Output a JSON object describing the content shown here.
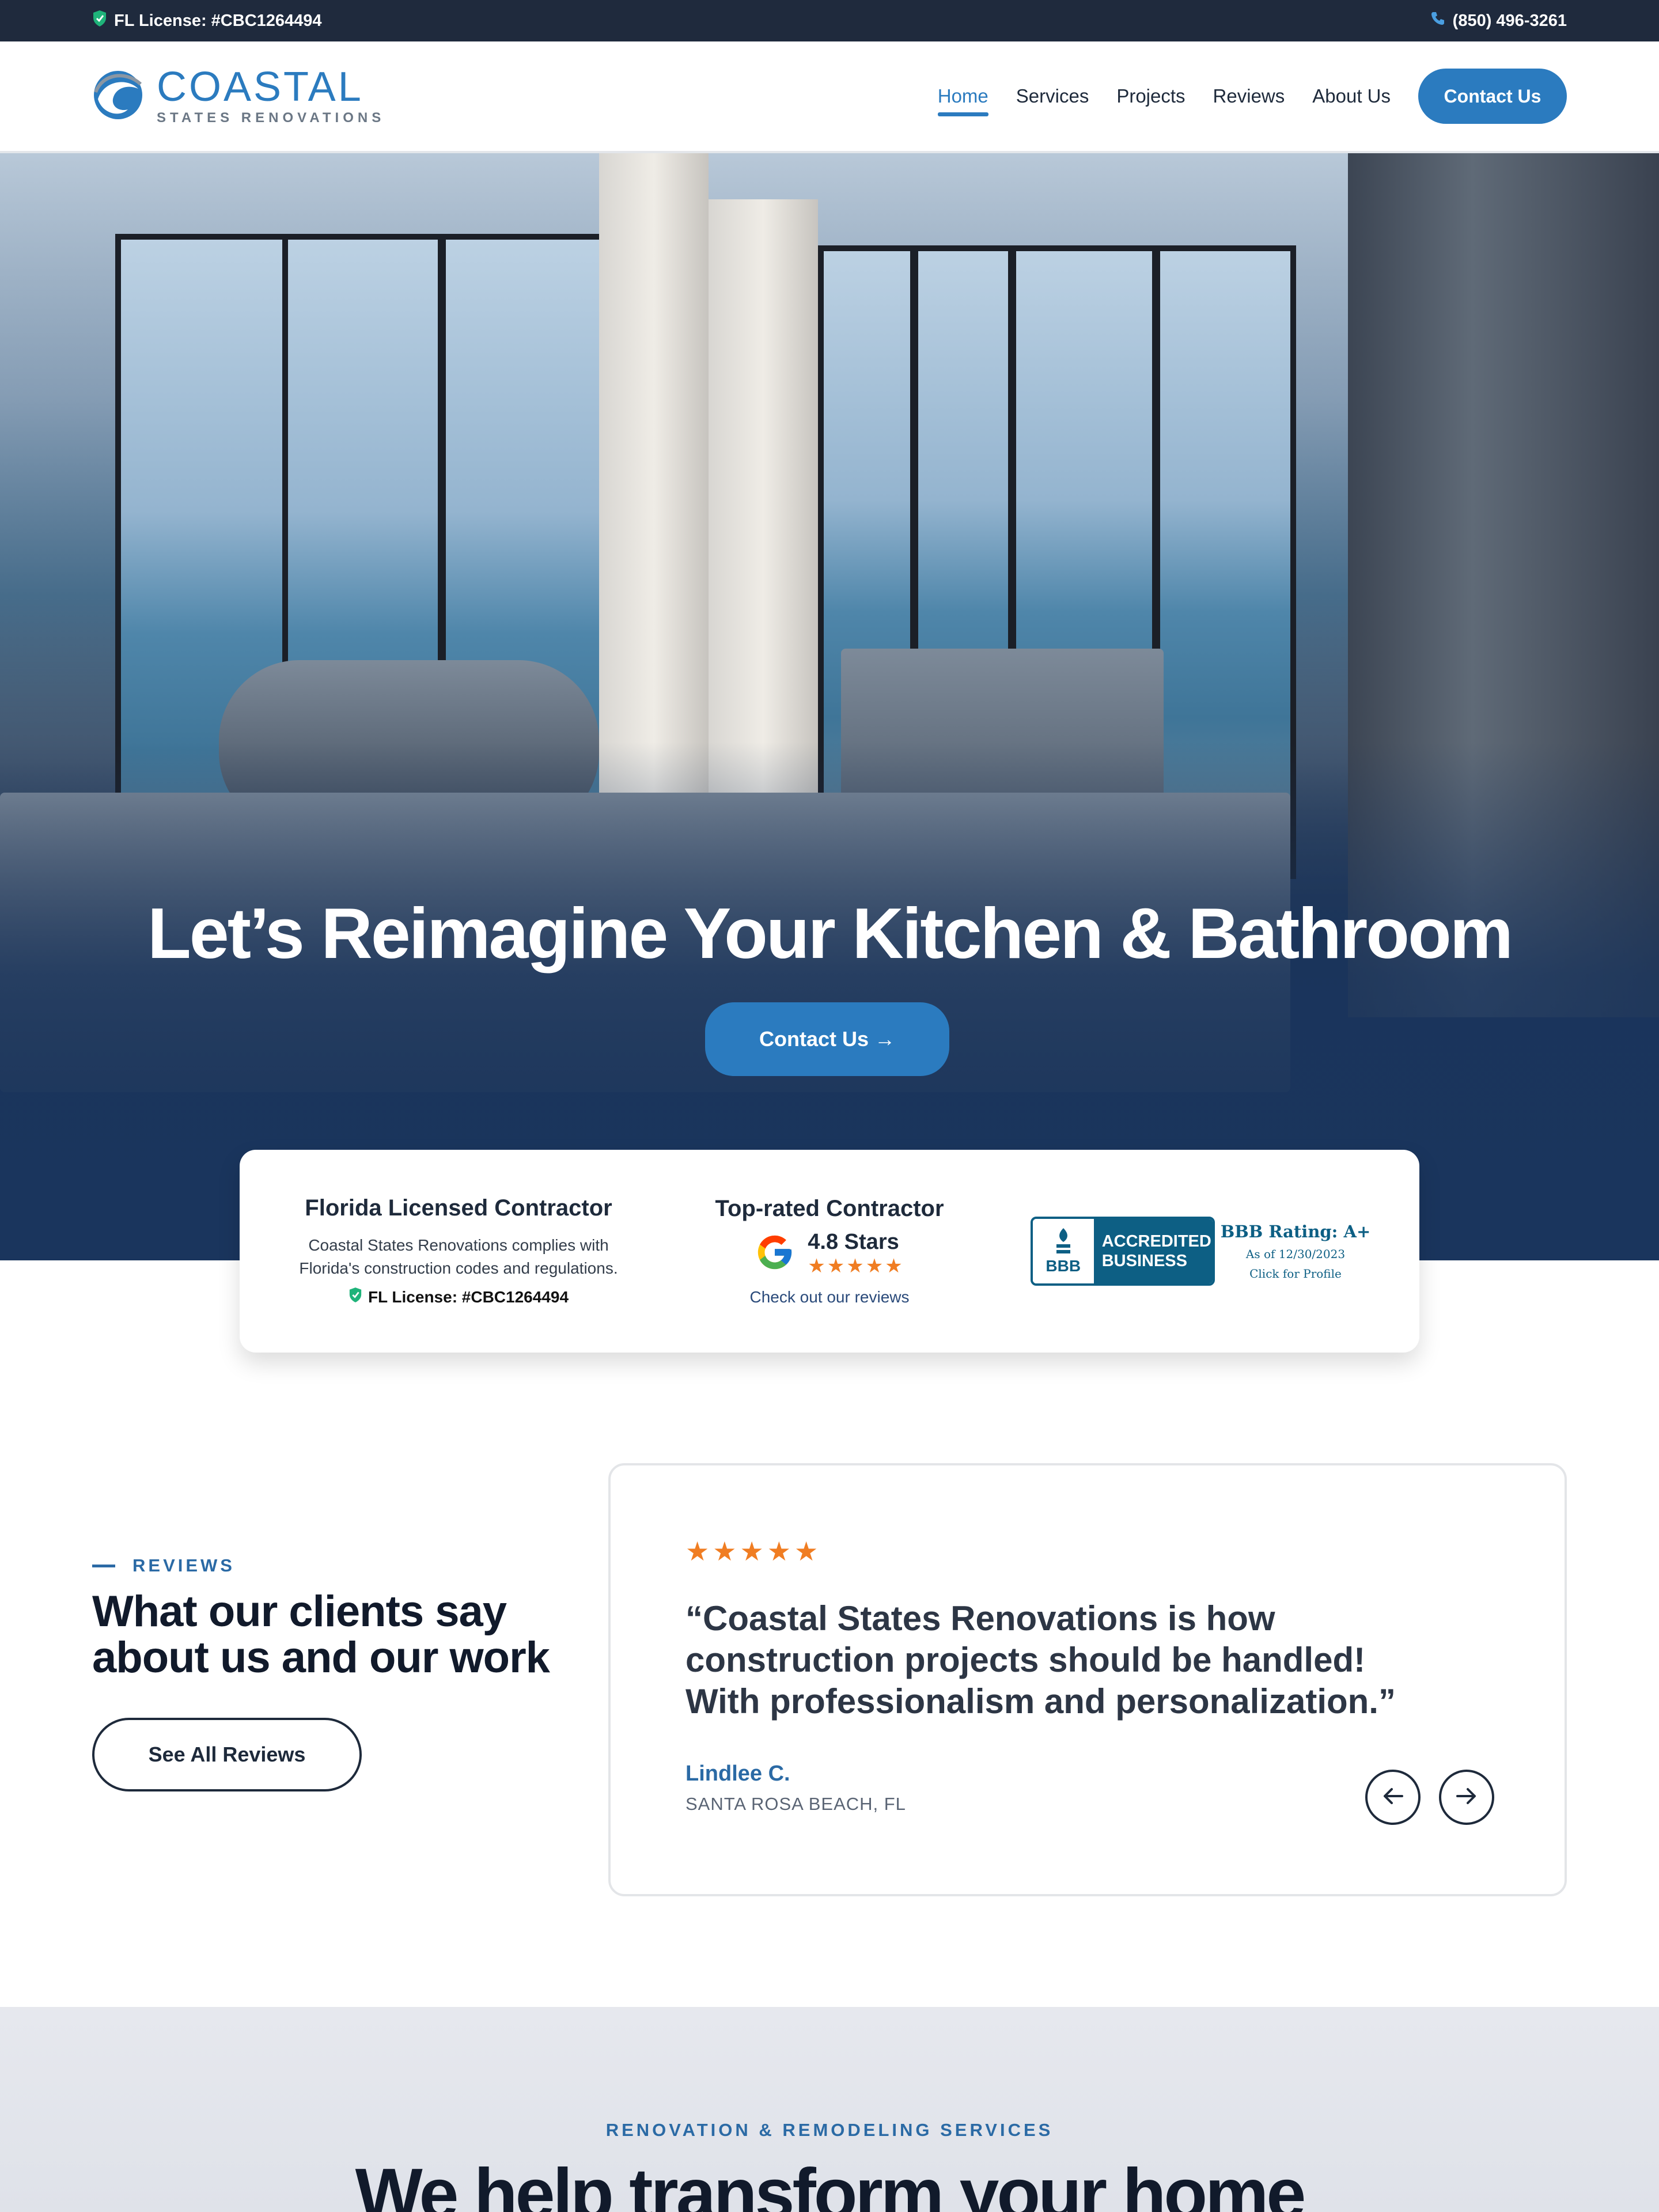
{
  "topbar": {
    "license": "FL License: #CBC1264494",
    "phone": "(850) 496-3261"
  },
  "header": {
    "logo_main": "COASTAL",
    "logo_sub": "STATES RENOVATIONS",
    "nav": [
      {
        "label": "Home",
        "active": true
      },
      {
        "label": "Services"
      },
      {
        "label": "Projects"
      },
      {
        "label": "Reviews"
      },
      {
        "label": "About Us"
      }
    ],
    "cta": "Contact Us"
  },
  "hero": {
    "title": "Let’s Reimagine Your Kitchen & Bathroom",
    "cta": "Contact Us →"
  },
  "trust": {
    "licensed_title": "Florida Licensed Contractor",
    "licensed_text_1": "Coastal States Renovations complies with",
    "licensed_text_2": "Florida's construction codes and regulations.",
    "license": "FL License: #CBC1264494",
    "rated_title": "Top-rated Contractor",
    "rating": "4.8 Stars",
    "stars": "★★★★★",
    "reviews_link": "Check out our reviews",
    "bbb_logo": "BBB",
    "bbb_accredited_1": "ACCREDITED",
    "bbb_accredited_2": "BUSINESS",
    "bbb_rating": "BBB Rating: A+",
    "bbb_asof": "As of 12/30/2023",
    "bbb_profile": "Click for Profile"
  },
  "reviews": {
    "eyebrow": "REVIEWS",
    "heading": "What our clients say about us and our work",
    "see_all": "See All Reviews",
    "stars": "★★★★★",
    "quote": "“Coastal States Renovations is how construction projects should be handled! With professionalism and personalization.”",
    "author": "Lindlee C.",
    "location": "SANTA ROSA BEACH, FL"
  },
  "services": {
    "eyebrow": "RENOVATION & REMODELING SERVICES",
    "heading": "We help transform your home"
  },
  "colors": {
    "accent": "#2b7bbf",
    "dark": "#1f2a3d",
    "star": "#f07d22",
    "license_check": "#1fb37a"
  }
}
